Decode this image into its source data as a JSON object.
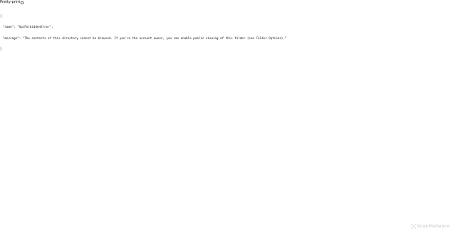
{
  "toolbar": {
    "pretty_print_label": "Pretty-print",
    "pretty_print_checked": false
  },
  "json": {
    "open_brace": "{",
    "lines": [
      "\"name\": \"ApiForbiddenError\",",
      "\"message\": \"The contents of this directory cannot be browsed. If you're the account owner, you can enable public viewing of this folder (see Folder Options).\""
    ],
    "close_brace": "}"
  },
  "watermark": {
    "text": "ScanMalware",
    "icon": "scan-malware-logo-icon",
    "color": "#d4d9df"
  }
}
